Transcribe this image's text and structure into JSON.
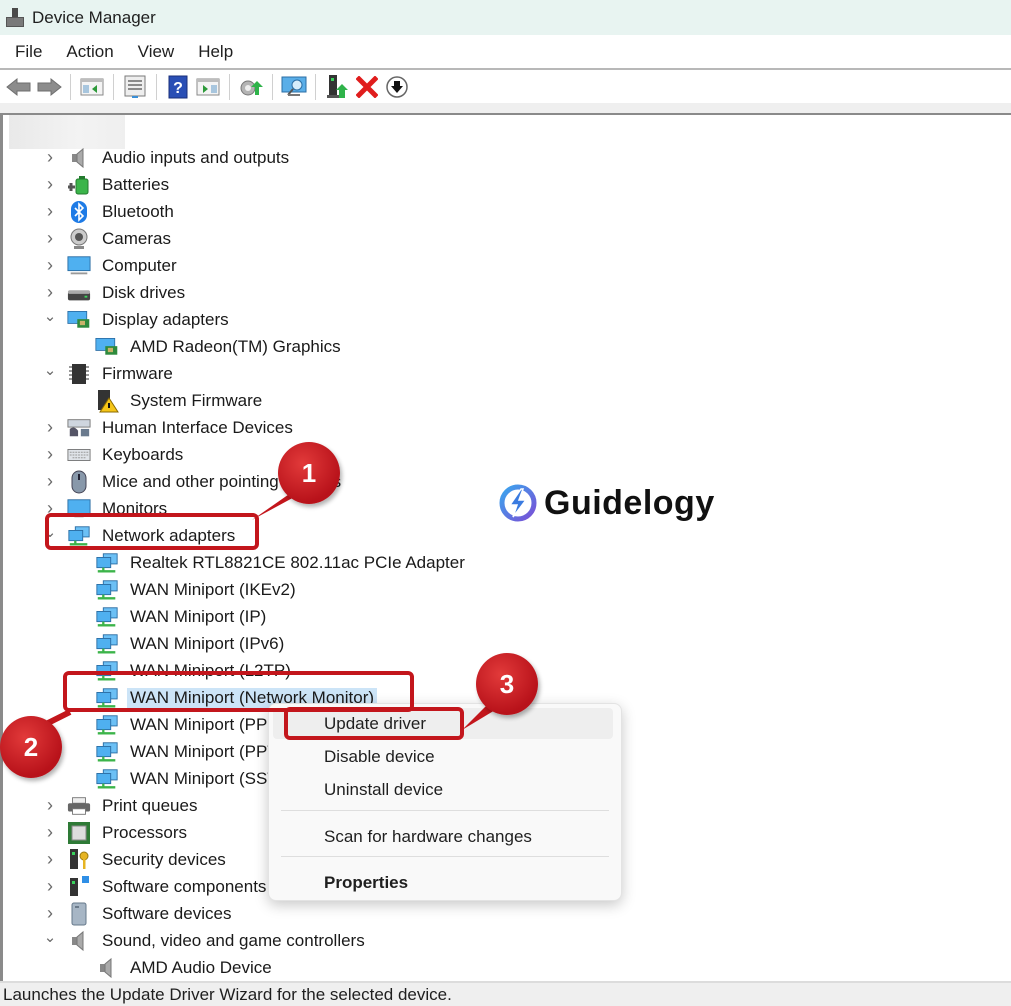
{
  "window": {
    "title": "Device Manager"
  },
  "menu": [
    "File",
    "Action",
    "View",
    "Help"
  ],
  "toolbar": {
    "buttons": [
      {
        "name": "back-button",
        "icon": "back-arrow-icon"
      },
      {
        "name": "forward-button",
        "icon": "forward-arrow-icon"
      },
      {
        "name": "show-hide-console-tree-button",
        "icon": "console-tree-icon"
      },
      {
        "name": "properties-button",
        "icon": "properties-icon"
      },
      {
        "name": "help-button",
        "icon": "help-icon"
      },
      {
        "name": "action-pane-button",
        "icon": "action-pane-icon"
      },
      {
        "name": "update-driver-button",
        "icon": "update-driver-icon"
      },
      {
        "name": "scan-hardware-button",
        "icon": "scan-monitor-icon"
      },
      {
        "name": "enable-device-button",
        "icon": "enable-device-icon"
      },
      {
        "name": "uninstall-device-button",
        "icon": "red-x-icon"
      },
      {
        "name": "disable-device-button",
        "icon": "down-arrow-circle-icon"
      }
    ]
  },
  "tree": [
    {
      "label": "Audio inputs and outputs",
      "level": 0,
      "expand": "collapsed",
      "icon": "speaker-icon"
    },
    {
      "label": "Batteries",
      "level": 0,
      "expand": "collapsed",
      "icon": "battery-icon"
    },
    {
      "label": "Bluetooth",
      "level": 0,
      "expand": "collapsed",
      "icon": "bluetooth-icon"
    },
    {
      "label": "Cameras",
      "level": 0,
      "expand": "collapsed",
      "icon": "webcam-icon"
    },
    {
      "label": "Computer",
      "level": 0,
      "expand": "collapsed",
      "icon": "computer-monitor-icon"
    },
    {
      "label": "Disk drives",
      "level": 0,
      "expand": "collapsed",
      "icon": "disk-drive-icon"
    },
    {
      "label": "Display adapters",
      "level": 0,
      "expand": "expanded",
      "icon": "display-adapter-icon"
    },
    {
      "label": "AMD Radeon(TM) Graphics",
      "level": 1,
      "expand": "none",
      "icon": "display-adapter-icon"
    },
    {
      "label": "Firmware",
      "level": 0,
      "expand": "expanded",
      "icon": "chip-icon"
    },
    {
      "label": "System Firmware",
      "level": 1,
      "expand": "none",
      "icon": "chip-warning-icon"
    },
    {
      "label": "Human Interface Devices",
      "level": 0,
      "expand": "collapsed",
      "icon": "hid-icon"
    },
    {
      "label": "Keyboards",
      "level": 0,
      "expand": "collapsed",
      "icon": "keyboard-icon"
    },
    {
      "label": "Mice and other pointing devices",
      "level": 0,
      "expand": "collapsed",
      "icon": "mouse-icon"
    },
    {
      "label": "Monitors",
      "level": 0,
      "expand": "collapsed",
      "icon": "monitor-icon"
    },
    {
      "label": "Network adapters",
      "level": 0,
      "expand": "expanded",
      "icon": "network-adapter-icon"
    },
    {
      "label": "Realtek RTL8821CE 802.11ac PCIe Adapter",
      "level": 1,
      "expand": "none",
      "icon": "network-adapter-icon"
    },
    {
      "label": "WAN Miniport (IKEv2)",
      "level": 1,
      "expand": "none",
      "icon": "network-adapter-icon"
    },
    {
      "label": "WAN Miniport (IP)",
      "level": 1,
      "expand": "none",
      "icon": "network-adapter-icon"
    },
    {
      "label": "WAN Miniport (IPv6)",
      "level": 1,
      "expand": "none",
      "icon": "network-adapter-icon"
    },
    {
      "label": "WAN Miniport (L2TP)",
      "level": 1,
      "expand": "none",
      "icon": "network-adapter-icon"
    },
    {
      "label": "WAN Miniport (Network Monitor)",
      "level": 1,
      "expand": "none",
      "icon": "network-adapter-icon",
      "selected": true
    },
    {
      "label": "WAN Miniport (PPPOE)",
      "level": 1,
      "expand": "none",
      "icon": "network-adapter-icon"
    },
    {
      "label": "WAN Miniport (PPTP)",
      "level": 1,
      "expand": "none",
      "icon": "network-adapter-icon"
    },
    {
      "label": "WAN Miniport (SSTP)",
      "level": 1,
      "expand": "none",
      "icon": "network-adapter-icon"
    },
    {
      "label": "Print queues",
      "level": 0,
      "expand": "collapsed",
      "icon": "printer-icon"
    },
    {
      "label": "Processors",
      "level": 0,
      "expand": "collapsed",
      "icon": "processor-icon"
    },
    {
      "label": "Security devices",
      "level": 0,
      "expand": "collapsed",
      "icon": "security-key-icon"
    },
    {
      "label": "Software components",
      "level": 0,
      "expand": "collapsed",
      "icon": "software-component-icon"
    },
    {
      "label": "Software devices",
      "level": 0,
      "expand": "collapsed",
      "icon": "software-device-icon"
    },
    {
      "label": "Sound, video and game controllers",
      "level": 0,
      "expand": "expanded",
      "icon": "speaker-icon"
    },
    {
      "label": "AMD Audio Device",
      "level": 1,
      "expand": "none",
      "icon": "speaker-icon"
    }
  ],
  "context_menu": {
    "items": [
      {
        "label": "Update driver",
        "highlighted": true
      },
      {
        "label": "Disable device"
      },
      {
        "label": "Uninstall device"
      },
      {
        "separator": true
      },
      {
        "label": "Scan for hardware changes"
      },
      {
        "separator": true
      },
      {
        "label": "Properties",
        "bold": true
      }
    ]
  },
  "annotations": [
    {
      "number": "1",
      "target": "Network adapters"
    },
    {
      "number": "2",
      "target": "WAN Miniport (Network Monitor)"
    },
    {
      "number": "3",
      "target": "Update driver"
    }
  ],
  "watermark": {
    "text": "Guidelogy"
  },
  "status": {
    "text": "Launches the Update Driver Wizard for the selected device."
  },
  "colors": {
    "accent_red": "#c3161c",
    "selection": "#cce4f7",
    "titlebar": "#e8f4f1"
  }
}
